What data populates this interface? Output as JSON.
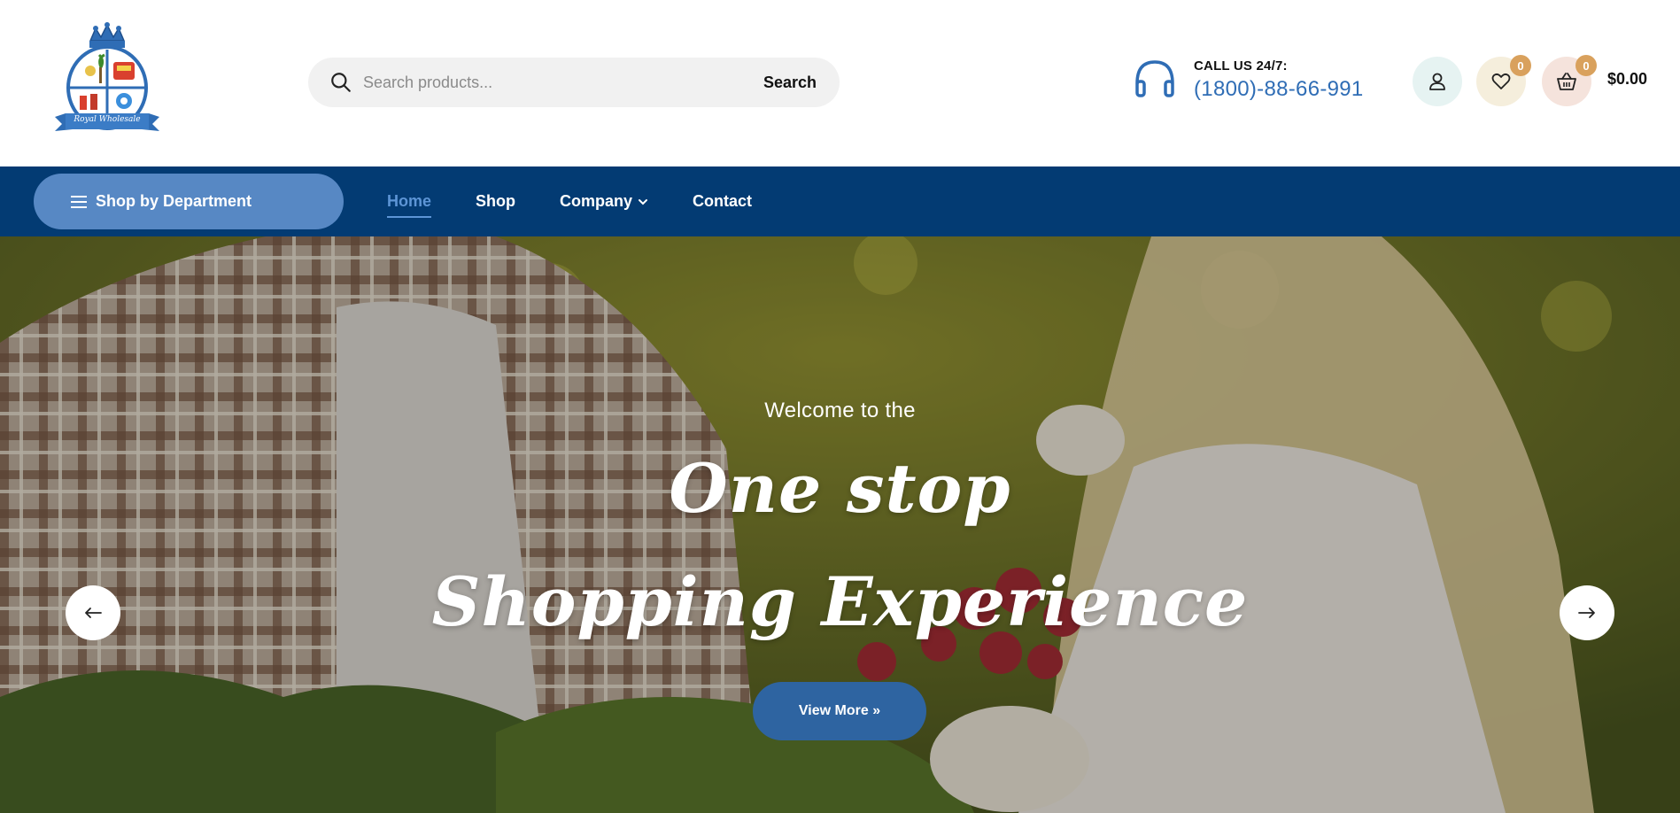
{
  "logo": {
    "text": "Royal Wholesale",
    "icon": "royal-wholesale-crest-icon"
  },
  "search": {
    "placeholder": "Search products...",
    "button_label": "Search",
    "icon": "search-icon"
  },
  "contact": {
    "label": "CALL US 24/7:",
    "phone": "(1800)-88-66-991",
    "icon": "headset-icon"
  },
  "header_actions": {
    "account_icon": "user-icon",
    "wishlist_count": "0",
    "cart_count": "0",
    "cart_total": "$0.00"
  },
  "nav": {
    "department_label": "Shop by Department",
    "links": [
      {
        "label": "Home",
        "active": true
      },
      {
        "label": "Shop",
        "active": false
      },
      {
        "label": "Company",
        "active": false,
        "has_dropdown": true
      },
      {
        "label": "Contact",
        "active": false
      }
    ]
  },
  "hero": {
    "welcome": "Welcome to the",
    "headline_line1": "One stop",
    "headline_line2": "Shopping Experience",
    "cta_label": "View More »",
    "prev_icon": "arrow-left-icon",
    "next_icon": "arrow-right-icon"
  },
  "colors": {
    "nav_bg": "#033b73",
    "department_button": "#5788c4",
    "accent_blue": "#2e64a1",
    "phone_blue": "#2f6db5",
    "badge": "#d9a15d"
  }
}
